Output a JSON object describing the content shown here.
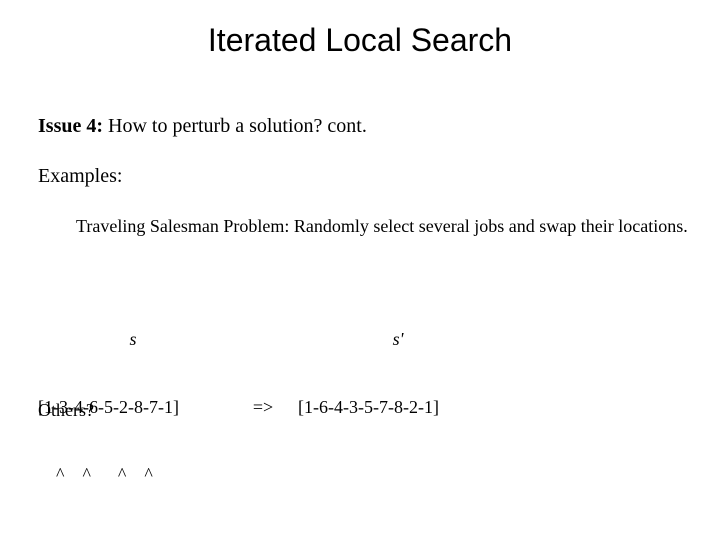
{
  "title": "Iterated Local Search",
  "issue": {
    "label": "Issue 4:",
    "text": " How to perturb a solution?   cont."
  },
  "examples_heading": "Examples:",
  "tsp_text": "Traveling Salesman Problem:  Randomly select several jobs and swap their locations.",
  "perturb": {
    "s_label": "s",
    "s_prime_label": "s'",
    "s_tour": "[1-3-4-6-5-2-8-7-1]",
    "arrow": "=>",
    "s_prime_tour": "[1-6-4-3-5-7-8-2-1]",
    "carets": "    ^    ^      ^    ^"
  },
  "others": "Others?"
}
